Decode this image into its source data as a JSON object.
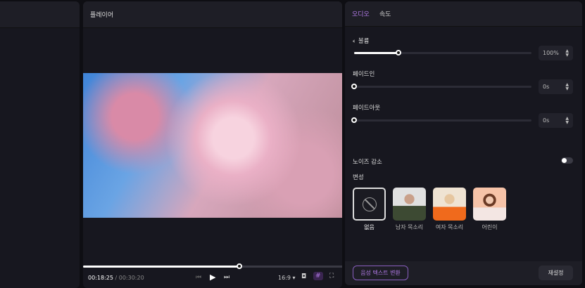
{
  "player": {
    "title": "플레이어",
    "current_time": "00:18:25",
    "total_time": "00:30:20",
    "separator": "/",
    "progress": 0.602,
    "aspect_ratio": "16:9"
  },
  "right": {
    "tabs": [
      {
        "label": "오디오",
        "active": true
      },
      {
        "label": "속도",
        "active": false
      }
    ],
    "volume": {
      "label": "볼륨",
      "value": "100%",
      "fraction": 0.25
    },
    "fade_in": {
      "label": "페이드인",
      "value": "0s",
      "fraction": 0
    },
    "fade_out": {
      "label": "페이드아웃",
      "value": "0s",
      "fraction": 0
    },
    "noise_reduction": {
      "label": "노이즈 감소",
      "enabled": false
    },
    "voice_change": {
      "label": "변성",
      "options": [
        {
          "label": "없음",
          "selected": true
        },
        {
          "label": "남자 목소리"
        },
        {
          "label": "여자 목소리"
        },
        {
          "label": "어린이"
        }
      ]
    },
    "tts_button": "음성 텍스트 변환",
    "reset_button": "재설정"
  },
  "colors": {
    "accent": "#b37be8"
  }
}
